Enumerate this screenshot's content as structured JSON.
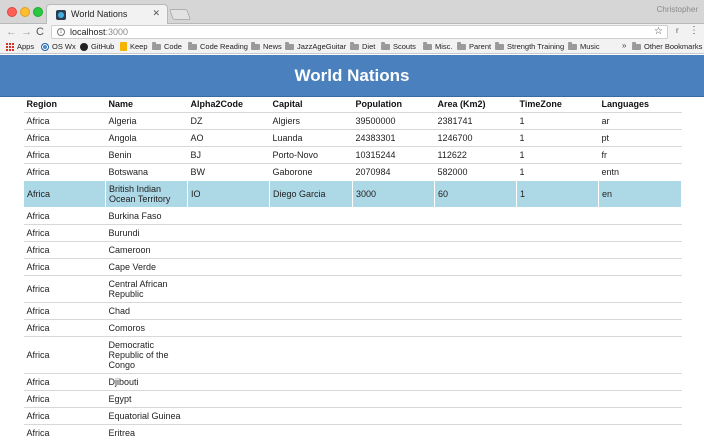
{
  "browser": {
    "tab_title": "World Nations",
    "tab_close": "✕",
    "profile_name": "Christopher",
    "url_host": "localhost",
    "url_port": ":3000",
    "nav": {
      "back": "←",
      "forward": "→",
      "reload": "C"
    },
    "info_glyph": "i",
    "star_glyph": "☆",
    "extension_glyph": "r",
    "menu_glyph": "⋮",
    "bookmarks": [
      {
        "label": "Apps",
        "icon": "apps-grid-icon"
      },
      {
        "label": "OS Wx",
        "icon": "os-wx-icon"
      },
      {
        "label": "GitHub",
        "icon": "github-icon"
      },
      {
        "label": "Keep",
        "icon": "keep-icon"
      },
      {
        "label": "Code",
        "icon": "folder-icon"
      },
      {
        "label": "Code Reading",
        "icon": "folder-icon"
      },
      {
        "label": "News",
        "icon": "folder-icon"
      },
      {
        "label": "JazzAgeGuitar",
        "icon": "folder-icon"
      },
      {
        "label": "Diet",
        "icon": "folder-icon"
      },
      {
        "label": "Scouts",
        "icon": "folder-icon"
      },
      {
        "label": "Misc.",
        "icon": "folder-icon"
      },
      {
        "label": "Parent",
        "icon": "folder-icon"
      },
      {
        "label": "Strength Training",
        "icon": "folder-icon"
      },
      {
        "label": "Music",
        "icon": "folder-icon"
      }
    ],
    "bookmarks_overflow": "»",
    "other_bookmarks": "Other Bookmarks"
  },
  "page": {
    "title": "World Nations",
    "columns": [
      "Region",
      "Name",
      "Alpha2Code",
      "Capital",
      "Population",
      "Area (Km2)",
      "TimeZone",
      "Languages"
    ],
    "rows": [
      {
        "region": "Africa",
        "name": "Algeria",
        "alpha2": "DZ",
        "capital": "Algiers",
        "population": "39500000",
        "area": "2381741",
        "timezone": "1",
        "languages": "ar"
      },
      {
        "region": "Africa",
        "name": "Angola",
        "alpha2": "AO",
        "capital": "Luanda",
        "population": "24383301",
        "area": "1246700",
        "timezone": "1",
        "languages": "pt"
      },
      {
        "region": "Africa",
        "name": "Benin",
        "alpha2": "BJ",
        "capital": "Porto-Novo",
        "population": "10315244",
        "area": "112622",
        "timezone": "1",
        "languages": "fr"
      },
      {
        "region": "Africa",
        "name": "Botswana",
        "alpha2": "BW",
        "capital": "Gaborone",
        "population": "2070984",
        "area": "582000",
        "timezone": "1",
        "languages": "entn"
      },
      {
        "region": "Africa",
        "name": "British Indian Ocean Territory",
        "alpha2": "IO",
        "capital": "Diego Garcia",
        "population": "3000",
        "area": "60",
        "timezone": "1",
        "languages": "en",
        "selected": true
      },
      {
        "region": "Africa",
        "name": "Burkina Faso",
        "alpha2": "",
        "capital": "",
        "population": "",
        "area": "",
        "timezone": "",
        "languages": ""
      },
      {
        "region": "Africa",
        "name": "Burundi",
        "alpha2": "",
        "capital": "",
        "population": "",
        "area": "",
        "timezone": "",
        "languages": ""
      },
      {
        "region": "Africa",
        "name": "Cameroon",
        "alpha2": "",
        "capital": "",
        "population": "",
        "area": "",
        "timezone": "",
        "languages": ""
      },
      {
        "region": "Africa",
        "name": "Cape Verde",
        "alpha2": "",
        "capital": "",
        "population": "",
        "area": "",
        "timezone": "",
        "languages": ""
      },
      {
        "region": "Africa",
        "name": "Central African Republic",
        "alpha2": "",
        "capital": "",
        "population": "",
        "area": "",
        "timezone": "",
        "languages": ""
      },
      {
        "region": "Africa",
        "name": "Chad",
        "alpha2": "",
        "capital": "",
        "population": "",
        "area": "",
        "timezone": "",
        "languages": ""
      },
      {
        "region": "Africa",
        "name": "Comoros",
        "alpha2": "",
        "capital": "",
        "population": "",
        "area": "",
        "timezone": "",
        "languages": ""
      },
      {
        "region": "Africa",
        "name": "Democratic Republic of the Congo",
        "alpha2": "",
        "capital": "",
        "population": "",
        "area": "",
        "timezone": "",
        "languages": ""
      },
      {
        "region": "Africa",
        "name": "Djibouti",
        "alpha2": "",
        "capital": "",
        "population": "",
        "area": "",
        "timezone": "",
        "languages": ""
      },
      {
        "region": "Africa",
        "name": "Egypt",
        "alpha2": "",
        "capital": "",
        "population": "",
        "area": "",
        "timezone": "",
        "languages": ""
      },
      {
        "region": "Africa",
        "name": "Equatorial Guinea",
        "alpha2": "",
        "capital": "",
        "population": "",
        "area": "",
        "timezone": "",
        "languages": ""
      },
      {
        "region": "Africa",
        "name": "Eritrea",
        "alpha2": "",
        "capital": "",
        "population": "",
        "area": "",
        "timezone": "",
        "languages": ""
      }
    ]
  },
  "colors": {
    "header_bg": "#4a80bd",
    "selected_row_bg": "#add8e6",
    "row_divider": "#d8d8d8"
  }
}
